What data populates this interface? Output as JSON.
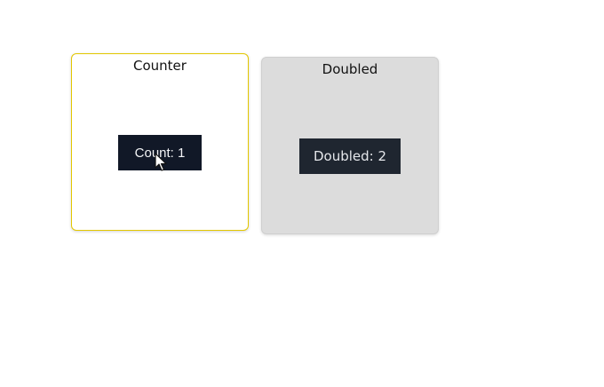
{
  "counter_card": {
    "title": "Counter",
    "button_label": "Count: 1"
  },
  "doubled_card": {
    "title": "Doubled",
    "value_label": "Doubled: 2"
  },
  "colors": {
    "active_border": "#e3c700",
    "button_bg": "#111827",
    "doubled_bg": "#dcdcdc"
  },
  "icons": {
    "cursor": "mouse-pointer-icon"
  }
}
